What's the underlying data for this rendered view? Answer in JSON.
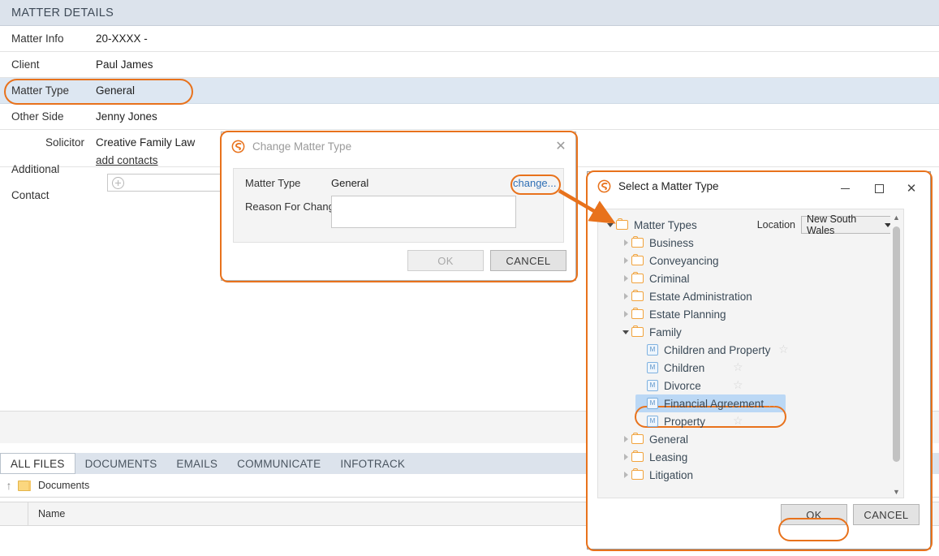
{
  "panel": {
    "header": "MATTER DETAILS",
    "rows": [
      {
        "label": "Matter Info",
        "value": "20-XXXX -"
      },
      {
        "label": "Client",
        "value": "Paul James"
      },
      {
        "label": "Matter Type",
        "value": "General"
      },
      {
        "label": "Other Side",
        "value": "Jenny Jones"
      },
      {
        "label": "Solicitor",
        "value": "Creative Family Law",
        "link": "add contacts"
      },
      {
        "label": "Additional Contact",
        "value": ""
      }
    ]
  },
  "tabs": {
    "items": [
      {
        "label": "ALL FILES",
        "active": true
      },
      {
        "label": "DOCUMENTS",
        "active": false
      },
      {
        "label": "EMAILS",
        "active": false
      },
      {
        "label": "COMMUNICATE",
        "active": false
      },
      {
        "label": "INFOTRACK",
        "active": false
      }
    ],
    "breadcrumb": "Documents",
    "column_name": "Name"
  },
  "change_dialog": {
    "title": "Change Matter Type",
    "close_icon": "close-icon",
    "matter_type_label": "Matter Type",
    "matter_type_value": "General",
    "change_link": "change...",
    "reason_label": "Reason For Change",
    "reason_value": "",
    "ok_label": "OK",
    "cancel_label": "CANCEL"
  },
  "select_dialog": {
    "title": "Select a Matter Type",
    "minimize_icon": "minimize-icon",
    "maximize_icon": "maximize-icon",
    "close_icon": "close-icon",
    "location_label": "Location",
    "location_value": "New South Wales",
    "ok_label": "OK",
    "cancel_label": "CANCEL",
    "tree": [
      {
        "label": "Matter Types",
        "type": "folder",
        "depth": 0,
        "state": "expanded",
        "star": false,
        "selected": false
      },
      {
        "label": "Business",
        "type": "folder",
        "depth": 1,
        "state": "collapsed",
        "star": false,
        "selected": false
      },
      {
        "label": "Conveyancing",
        "type": "folder",
        "depth": 1,
        "state": "collapsed",
        "star": false,
        "selected": false
      },
      {
        "label": "Criminal",
        "type": "folder",
        "depth": 1,
        "state": "collapsed",
        "star": false,
        "selected": false
      },
      {
        "label": "Estate Administration",
        "type": "folder",
        "depth": 1,
        "state": "collapsed",
        "star": false,
        "selected": false
      },
      {
        "label": "Estate Planning",
        "type": "folder",
        "depth": 1,
        "state": "collapsed",
        "star": false,
        "selected": false
      },
      {
        "label": "Family",
        "type": "folder",
        "depth": 1,
        "state": "expanded",
        "star": false,
        "selected": false
      },
      {
        "label": "Children and Property",
        "type": "mattertype",
        "depth": 2,
        "state": "leaf",
        "star": true,
        "selected": false
      },
      {
        "label": "Children",
        "type": "mattertype",
        "depth": 2,
        "state": "leaf",
        "star": true,
        "selected": false
      },
      {
        "label": "Divorce",
        "type": "mattertype",
        "depth": 2,
        "state": "leaf",
        "star": true,
        "selected": false
      },
      {
        "label": "Financial Agreement",
        "type": "mattertype",
        "depth": 2,
        "state": "leaf",
        "star": true,
        "selected": true
      },
      {
        "label": "Property",
        "type": "mattertype",
        "depth": 2,
        "state": "leaf",
        "star": true,
        "selected": false
      },
      {
        "label": "General",
        "type": "folder",
        "depth": 1,
        "state": "collapsed",
        "star": false,
        "selected": false
      },
      {
        "label": "Leasing",
        "type": "folder",
        "depth": 1,
        "state": "collapsed",
        "star": false,
        "selected": false
      },
      {
        "label": "Litigation",
        "type": "folder",
        "depth": 1,
        "state": "collapsed",
        "star": false,
        "selected": false
      }
    ]
  },
  "colors": {
    "accent": "#e8721c",
    "header_bg": "#dce3ec",
    "selected_row": "#dde7f2",
    "tree_selection": "#bbd8f5",
    "link": "#2f6fb5",
    "folder_outline": "#f2a33c"
  }
}
